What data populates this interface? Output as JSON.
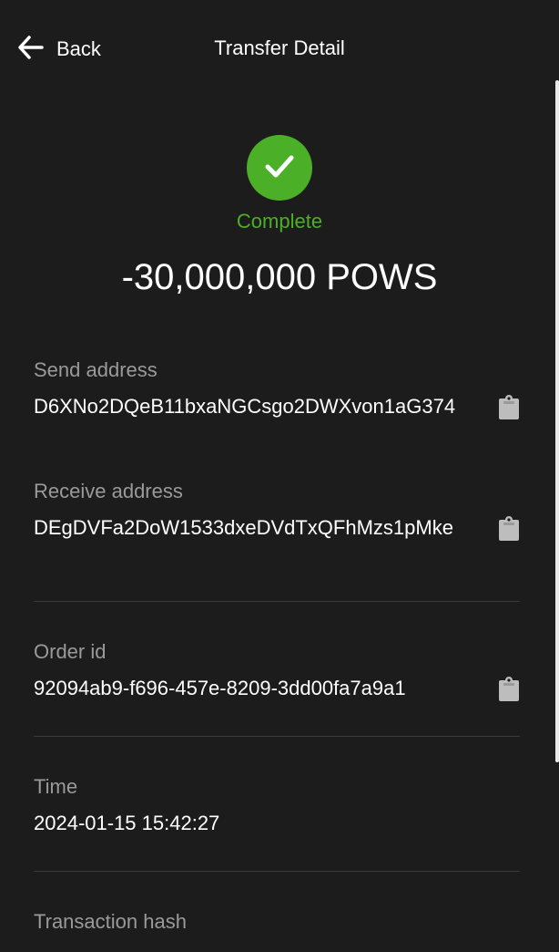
{
  "header": {
    "back_label": "Back",
    "title": "Transfer Detail"
  },
  "status": {
    "text": "Complete",
    "color": "#4caf28",
    "icon": "check-icon"
  },
  "amount": "-30,000,000 POWS",
  "fields": {
    "send_address": {
      "label": "Send address",
      "value": "D6XNo2DQeB11bxaNGCsgo2DWXvon1aG374"
    },
    "receive_address": {
      "label": "Receive address",
      "value": "DEgDVFa2DoW1533dxeDVdTxQFhMzs1pMke"
    },
    "order_id": {
      "label": "Order id",
      "value": "92094ab9-f696-457e-8209-3dd00fa7a9a1"
    },
    "time": {
      "label": "Time",
      "value": "2024-01-15 15:42:27"
    },
    "transaction_hash": {
      "label": "Transaction hash"
    }
  },
  "icons": {
    "back": "arrow-left-icon",
    "copy": "clipboard-icon"
  },
  "colors": {
    "background": "#1c1c1c",
    "success": "#4caf28",
    "label": "#9a9a9a",
    "divider": "#3a3a3a"
  }
}
